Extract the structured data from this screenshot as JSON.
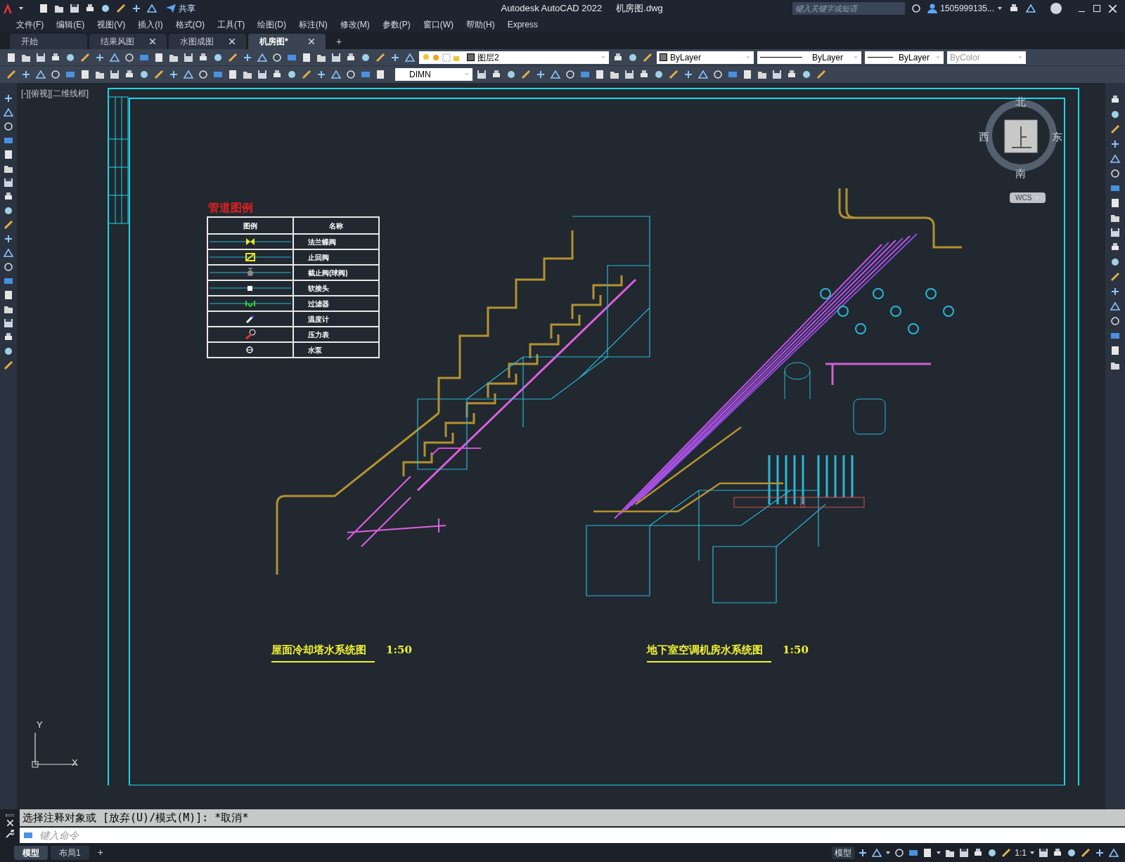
{
  "title_bar": {
    "app_title": "Autodesk AutoCAD 2022",
    "file_name": "机房图.dwg",
    "share": "共享",
    "search": {
      "placeholder": "键入关键字或短语"
    },
    "user": "1505999135..."
  },
  "menu": [
    "文件(F)",
    "编辑(E)",
    "视图(V)",
    "插入(I)",
    "格式(O)",
    "工具(T)",
    "绘图(D)",
    "标注(N)",
    "修改(M)",
    "参数(P)",
    "窗口(W)",
    "帮助(H)",
    "Express"
  ],
  "file_tabs": [
    {
      "label": "开始",
      "closable": false,
      "selected": false
    },
    {
      "label": "结果风图",
      "closable": true,
      "selected": false
    },
    {
      "label": "水图成图",
      "closable": true,
      "selected": false
    },
    {
      "label": "机房图*",
      "closable": true,
      "selected": true
    }
  ],
  "file_tab_add": "+",
  "toolbar": {
    "layer": "图层2",
    "object_color": "ByLayer",
    "linetype": "ByLayer",
    "lineweight": "ByLayer",
    "plot_style": "ByColor",
    "dim_style": "DIMN"
  },
  "viewport_label": "[-][俯视][二维线框]",
  "viewcube": {
    "north": "北",
    "south": "南",
    "west": "西",
    "east": "东",
    "ucs": "WCS"
  },
  "legend": {
    "title": "管道图例",
    "columns": [
      "图例",
      "名称"
    ],
    "rows": [
      {
        "kind": "butterfly",
        "name": "法兰蝶阀"
      },
      {
        "kind": "check",
        "name": "止回阀"
      },
      {
        "kind": "globe",
        "name": "截止阀(球阀)"
      },
      {
        "kind": "joint",
        "name": "软接头"
      },
      {
        "kind": "filter",
        "name": "过滤器"
      },
      {
        "kind": "thermometer",
        "name": "温度计"
      },
      {
        "kind": "gauge",
        "name": "压力表"
      },
      {
        "kind": "pump",
        "name": "水泵"
      }
    ]
  },
  "drawing_titles": [
    {
      "title": "屋面冷却塔水系统图",
      "scale": "1:50"
    },
    {
      "title": "地下室空调机房水系统图",
      "scale": "1:50"
    }
  ],
  "axes": {
    "x": "X",
    "y": "Y"
  },
  "command": {
    "history": "选择注释对象或 [放弃(U)/模式(M)]: *取消*",
    "placeholder": "键入命令"
  },
  "layout_tabs": [
    {
      "label": "模型",
      "selected": true
    },
    {
      "label": "布局1",
      "selected": false
    }
  ],
  "layout_tab_add": "+",
  "status_bar": {
    "mode": "模型",
    "scale": "1:1"
  }
}
